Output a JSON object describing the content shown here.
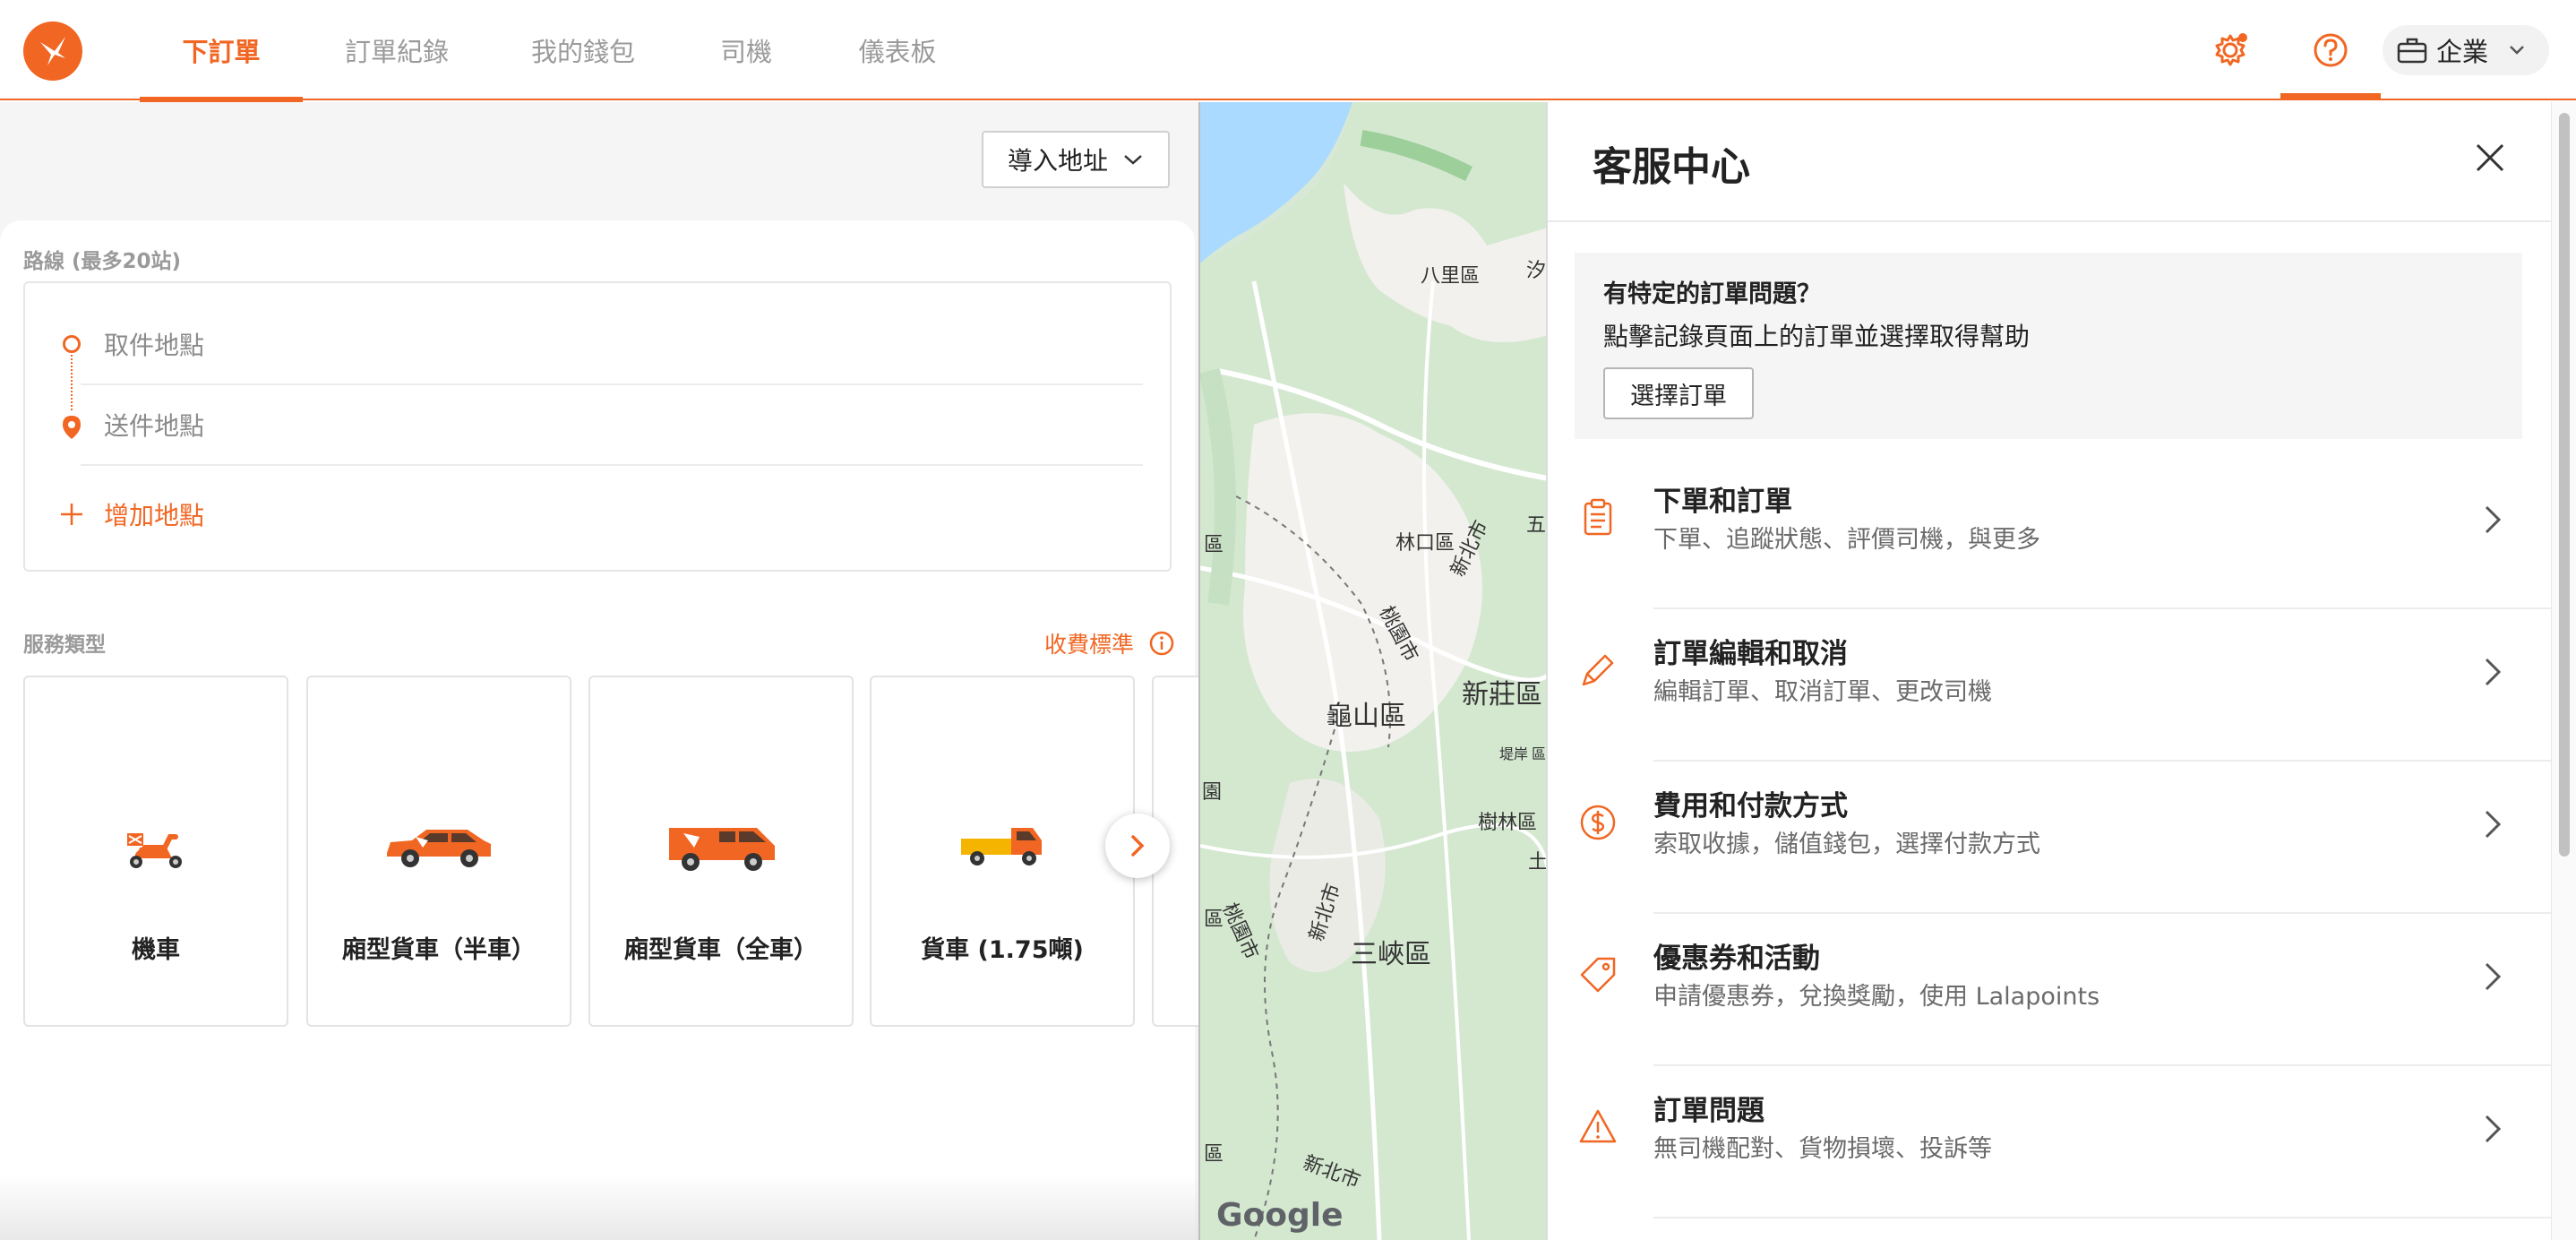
{
  "nav": {
    "tabs": [
      {
        "label": "下訂單",
        "active": true
      },
      {
        "label": "訂單紀錄",
        "active": false
      },
      {
        "label": "我的錢包",
        "active": false
      },
      {
        "label": "司機",
        "active": false
      },
      {
        "label": "儀表板",
        "active": false
      }
    ],
    "account_label": "企業",
    "help_tooltip": "幫助",
    "icons": [
      "logo-icon",
      "gear-icon",
      "help-icon",
      "briefcase-icon",
      "chevron-down-icon"
    ]
  },
  "order_form": {
    "import_button": "導入地址",
    "route_label": "路線 (最多20站)",
    "pickup_placeholder": "取件地點",
    "dropoff_placeholder": "送件地點",
    "add_stop": "增加地點",
    "service_label": "服務類型",
    "fee_link": "收費標準",
    "services": [
      {
        "name": "機車",
        "icon": "scooter-icon"
      },
      {
        "name": "廂型貨車（半車）",
        "icon": "suv-icon"
      },
      {
        "name": "廂型貨車（全車）",
        "icon": "van-icon"
      },
      {
        "name": "貨車 (1.75噸)",
        "icon": "truck-icon"
      }
    ]
  },
  "map": {
    "labels": {
      "l1": "八里區",
      "l2": "林口區",
      "l3": "新北市",
      "l4": "桃園市",
      "l5": "新莊區",
      "l6": "龜山區",
      "l7": "三峽區",
      "l8": "樹林區",
      "l9": "桃園市",
      "l10": "新北市",
      "l11": "新北市",
      "l12": "區",
      "l13": "區",
      "l14": "園",
      "l15": "區",
      "l16": "汐",
      "l17": "五",
      "l18": "土",
      "l19": "堤岸",
      "l20": "區"
    },
    "attribution": "Google"
  },
  "help": {
    "title": "客服中心",
    "order_question": "有特定的訂單問題？",
    "order_desc": "點擊記錄頁面上的訂單並選擇取得幫助",
    "select_order": "選擇訂單",
    "items": [
      {
        "title": "下單和訂單",
        "sub": "下單、追蹤狀態、評價司機，與更多",
        "icon": "clipboard-icon"
      },
      {
        "title": "訂單編輯和取消",
        "sub": "編輯訂單、取消訂單、更改司機",
        "icon": "pencil-icon"
      },
      {
        "title": "費用和付款方式",
        "sub": "索取收據，儲值錢包，選擇付款方式",
        "icon": "dollar-icon"
      },
      {
        "title": "優惠券和活動",
        "sub": "申請優惠券，兌換獎勵，使用 Lalapoints",
        "icon": "tag-icon"
      },
      {
        "title": "訂單問題",
        "sub": "無司機配對、貨物損壞、投訴等",
        "icon": "warning-icon"
      }
    ]
  },
  "colors": {
    "brand": "#f16622",
    "text": "#222222",
    "muted": "#9a9a9a"
  }
}
